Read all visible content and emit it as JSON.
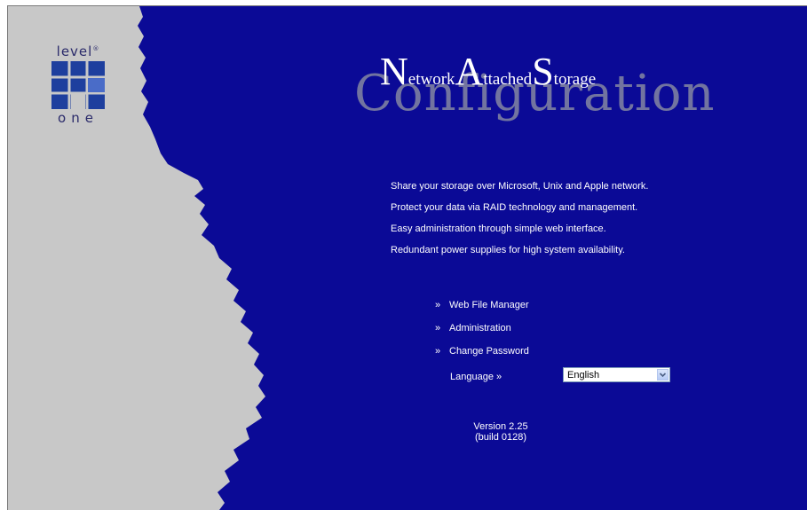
{
  "brand": {
    "logo_top": "level",
    "logo_registered": "®",
    "logo_bottom": "one"
  },
  "title": {
    "background_word": "Configuration",
    "n_cap": "N",
    "n_rest": "etwork",
    "a_cap": "A",
    "a_rest": "ttached",
    "s_cap": "S",
    "s_rest": "torage"
  },
  "features": [
    "Share your storage over Microsoft, Unix and Apple network.",
    "Protect your data via RAID technology and management.",
    "Easy administration through simple web interface.",
    "Redundant power supplies for high system availability."
  ],
  "menu": {
    "bullet": "»",
    "items": [
      "Web File Manager",
      "Administration",
      "Change Password"
    ]
  },
  "language": {
    "label": "Language »",
    "selected": "English"
  },
  "version": {
    "line1": "Version 2.25",
    "line2": "(build 0128)"
  },
  "colors": {
    "background_blue": "#0b0a96",
    "torn_gray": "#c8c8c8",
    "logo_blue": "#1e3f9e",
    "text_white": "#ffffff"
  },
  "icons": {
    "logo": "levelone-logo",
    "dropdown": "chevron-down-icon"
  }
}
